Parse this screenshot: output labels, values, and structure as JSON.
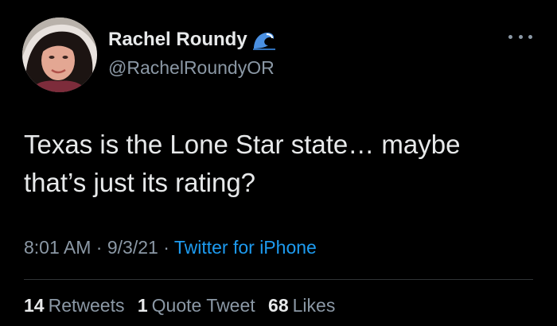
{
  "author": {
    "name": "Rachel Roundy",
    "handle": "@RachelRoundyOR",
    "badge_icon": "wave-emoji-icon"
  },
  "tweet": {
    "lines": [
      "Texas is the Lone Star state… maybe",
      "that’s just its rating?"
    ]
  },
  "meta": {
    "time": "8:01 AM",
    "separator": "·",
    "date": "9/3/21",
    "source": "Twitter for iPhone"
  },
  "stats": {
    "retweets_count": "14",
    "retweets_label": "Retweets",
    "quotes_count": "1",
    "quotes_label": "Quote Tweet",
    "likes_count": "68",
    "likes_label": "Likes"
  },
  "colors": {
    "background": "#000000",
    "text": "#e7e9ea",
    "secondary": "#8b98a5",
    "link": "#1d9bf0",
    "divider": "#2f3336"
  }
}
